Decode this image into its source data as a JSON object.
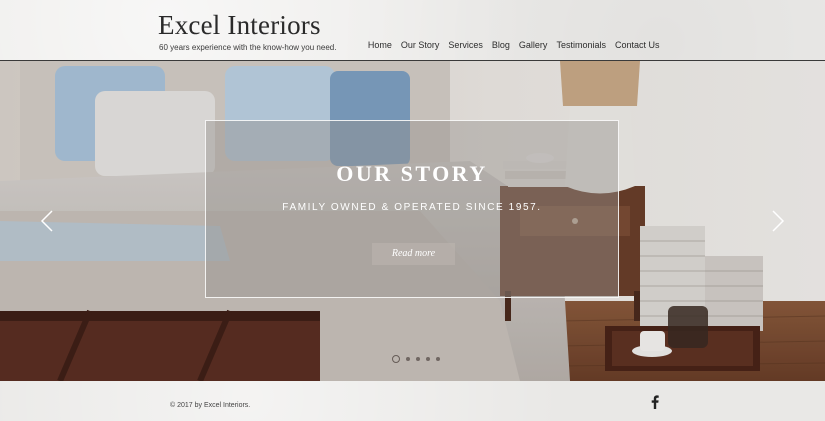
{
  "header": {
    "brand": "Excel Interiors",
    "tagline": "60 years experience with the know-how you need.",
    "nav": [
      "Home",
      "Our Story",
      "Services",
      "Blog",
      "Gallery",
      "Testimonials",
      "Contact Us"
    ]
  },
  "hero": {
    "title": "OUR STORY",
    "subtitle": "FAMILY OWNED & OPERATED SINCE 1957.",
    "cta_label": "Read more",
    "slide_count": 5,
    "active_slide": 1
  },
  "footer": {
    "copyright": "© 2017 by Excel Interiors.",
    "social_icon": "facebook-icon"
  },
  "colors": {
    "header_bg": "#ecebe9",
    "text_dark": "#2a2a2a",
    "overlay": "#96928e"
  }
}
